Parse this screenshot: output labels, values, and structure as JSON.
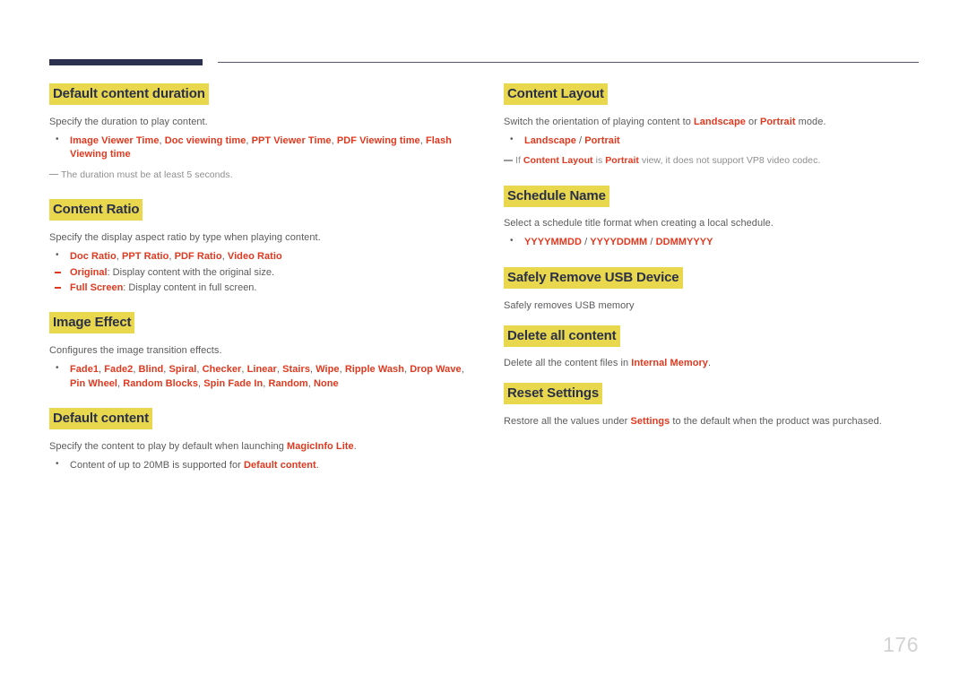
{
  "document": {
    "page_number": "176",
    "colors": {
      "heading_highlight": "#e9d84e",
      "heading_text": "#2b3049",
      "body_text": "#5b5b5e",
      "accent_red": "#e0391f",
      "note_text": "#8e8e91",
      "rule_dark": "#2c3150",
      "rule_thin": "#55556e",
      "page_number": "#d2d2d4"
    }
  },
  "left_column": {
    "sections": [
      {
        "title": "Default content duration",
        "body": "Specify the duration to play content.",
        "bullet": {
          "parts": [
            {
              "text": "Image Viewer Time",
              "style": "red"
            },
            {
              "text": ", ",
              "style": "gray"
            },
            {
              "text": "Doc viewing time",
              "style": "red"
            },
            {
              "text": ", ",
              "style": "gray"
            },
            {
              "text": "PPT Viewer Time",
              "style": "red"
            },
            {
              "text": ", ",
              "style": "gray"
            },
            {
              "text": "PDF Viewing time",
              "style": "red"
            },
            {
              "text": ", ",
              "style": "gray"
            },
            {
              "text": "Flash Viewing time",
              "style": "red"
            }
          ]
        },
        "note": "The duration must be at least 5 seconds."
      },
      {
        "title": "Content Ratio",
        "body": "Specify the display aspect ratio by type when playing content.",
        "bullet": {
          "parts": [
            {
              "text": "Doc Ratio",
              "style": "red"
            },
            {
              "text": ", ",
              "style": "gray"
            },
            {
              "text": "PPT Ratio",
              "style": "red"
            },
            {
              "text": ", ",
              "style": "gray"
            },
            {
              "text": "PDF Ratio",
              "style": "red"
            },
            {
              "text": ", ",
              "style": "gray"
            },
            {
              "text": "Video Ratio",
              "style": "red"
            }
          ]
        },
        "sub_items": [
          {
            "parts": [
              {
                "text": "Original",
                "style": "red"
              },
              {
                "text": ": Display content with the original size.",
                "style": "gray"
              }
            ]
          },
          {
            "parts": [
              {
                "text": "Full Screen",
                "style": "red"
              },
              {
                "text": ": Display content in full screen.",
                "style": "gray"
              }
            ]
          }
        ]
      },
      {
        "title": "Image Effect",
        "body": "Configures the image transition effects.",
        "bullet": {
          "parts": [
            {
              "text": "Fade1",
              "style": "red"
            },
            {
              "text": ", ",
              "style": "gray"
            },
            {
              "text": "Fade2",
              "style": "red"
            },
            {
              "text": ", ",
              "style": "gray"
            },
            {
              "text": "Blind",
              "style": "red"
            },
            {
              "text": ", ",
              "style": "gray"
            },
            {
              "text": "Spiral",
              "style": "red"
            },
            {
              "text": ", ",
              "style": "gray"
            },
            {
              "text": "Checker",
              "style": "red"
            },
            {
              "text": ", ",
              "style": "gray"
            },
            {
              "text": "Linear",
              "style": "red"
            },
            {
              "text": ", ",
              "style": "gray"
            },
            {
              "text": "Stairs",
              "style": "red"
            },
            {
              "text": ", ",
              "style": "gray"
            },
            {
              "text": "Wipe",
              "style": "red"
            },
            {
              "text": ", ",
              "style": "gray"
            },
            {
              "text": "Ripple Wash",
              "style": "red"
            },
            {
              "text": ", ",
              "style": "gray"
            },
            {
              "text": "Drop Wave",
              "style": "red"
            },
            {
              "text": ", ",
              "style": "gray"
            },
            {
              "text": "Pin Wheel",
              "style": "red"
            },
            {
              "text": ", ",
              "style": "gray"
            },
            {
              "text": "Random Blocks",
              "style": "red"
            },
            {
              "text": ", ",
              "style": "gray"
            },
            {
              "text": "Spin Fade In",
              "style": "red"
            },
            {
              "text": ", ",
              "style": "gray"
            },
            {
              "text": "Random",
              "style": "red"
            },
            {
              "text": ", ",
              "style": "gray"
            },
            {
              "text": "None",
              "style": "red"
            }
          ]
        }
      },
      {
        "title": "Default content",
        "body_parts": [
          {
            "text": "Specify the content to play by default when launching ",
            "style": "gray"
          },
          {
            "text": "MagicInfo Lite",
            "style": "red"
          },
          {
            "text": ".",
            "style": "gray"
          }
        ],
        "bullet": {
          "parts": [
            {
              "text": "Content of up to 20MB is supported for ",
              "style": "gray"
            },
            {
              "text": "Default content",
              "style": "red"
            },
            {
              "text": ".",
              "style": "gray"
            }
          ]
        }
      }
    ]
  },
  "right_column": {
    "sections": [
      {
        "title": "Content Layout",
        "body_parts": [
          {
            "text": "Switch the orientation of playing content to ",
            "style": "gray"
          },
          {
            "text": "Landscape",
            "style": "red"
          },
          {
            "text": " or ",
            "style": "gray"
          },
          {
            "text": "Portrait",
            "style": "red"
          },
          {
            "text": " mode.",
            "style": "gray"
          }
        ],
        "bullet": {
          "parts": [
            {
              "text": "Landscape",
              "style": "red"
            },
            {
              "text": " / ",
              "style": "gray"
            },
            {
              "text": "Portrait",
              "style": "red"
            }
          ]
        },
        "note_parts": [
          {
            "text": "If ",
            "style": "note"
          },
          {
            "text": "Content Layout",
            "style": "red"
          },
          {
            "text": " is ",
            "style": "note"
          },
          {
            "text": "Portrait",
            "style": "red"
          },
          {
            "text": " view, it does not support VP8 video codec.",
            "style": "note"
          }
        ]
      },
      {
        "title": "Schedule Name",
        "body": "Select a schedule title format when creating a local schedule.",
        "bullet": {
          "parts": [
            {
              "text": "YYYYMMDD",
              "style": "red"
            },
            {
              "text": " / ",
              "style": "gray"
            },
            {
              "text": "YYYYDDMM",
              "style": "red"
            },
            {
              "text": " / ",
              "style": "gray"
            },
            {
              "text": "DDMMYYYY",
              "style": "red"
            }
          ]
        }
      },
      {
        "title": "Safely Remove USB Device",
        "body": "Safely removes USB memory"
      },
      {
        "title": "Delete all content",
        "body_parts": [
          {
            "text": "Delete all the content files in ",
            "style": "gray"
          },
          {
            "text": "Internal Memory",
            "style": "red"
          },
          {
            "text": ".",
            "style": "gray"
          }
        ]
      },
      {
        "title": "Reset Settings",
        "body_parts": [
          {
            "text": "Restore all the values under ",
            "style": "gray"
          },
          {
            "text": "Settings",
            "style": "red"
          },
          {
            "text": " to the default when the product was purchased.",
            "style": "gray"
          }
        ]
      }
    ]
  }
}
